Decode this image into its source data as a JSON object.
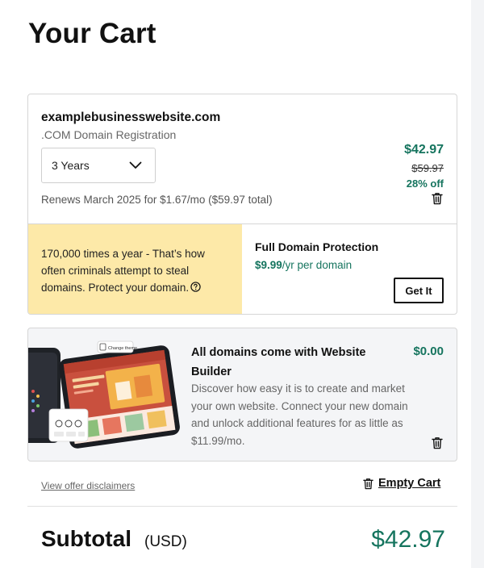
{
  "page": {
    "title": "Your Cart"
  },
  "domain_item": {
    "domain": "examplebusinesswebsite.com",
    "product": ".COM Domain Registration",
    "term": {
      "selected": "3 Years"
    },
    "renewal_note": "Renews March 2025 for $1.67/mo ($59.97 total)",
    "price": "$42.97",
    "original_price": "$59.97",
    "discount": "28% off"
  },
  "protection": {
    "warning_text": "170,000 times a year - That’s how often criminals attempt to steal domains. Protect your domain.",
    "title": "Full Domain Protection",
    "price": "$9.99",
    "price_suffix": "/yr per domain",
    "cta": "Get It"
  },
  "website_builder": {
    "art_label": "Change theme",
    "title": "All domains come with Website Builder",
    "description": "Discover how easy it is to create and market your own website. Connect your new domain and unlock additional features for as little as $11.99/mo.",
    "price": "$0.00"
  },
  "footer": {
    "disclaimers_link": "View offer disclaimers",
    "empty_cart": "Empty Cart",
    "subtotal_label": "Subtotal",
    "subtotal_currency": "(USD)",
    "subtotal_value": "$42.97"
  },
  "colors": {
    "accent_green": "#15745e",
    "warning_bg": "#fde9a8",
    "card_alt_bg": "#f4f5f7"
  },
  "icons": [
    "chevron-down-icon",
    "trash-icon",
    "info-icon"
  ]
}
